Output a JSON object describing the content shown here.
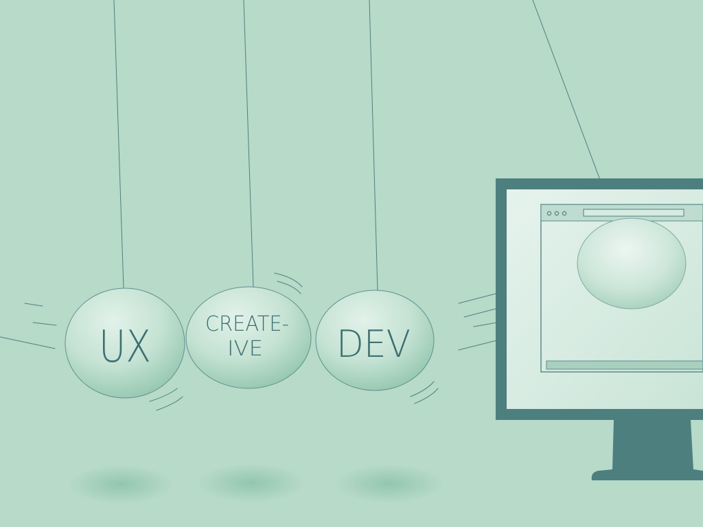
{
  "illustration": {
    "balls": [
      {
        "name": "ux",
        "label_lines": [
          "UX"
        ]
      },
      {
        "name": "create-ive",
        "label_lines": [
          "CREATE-",
          "IVE"
        ]
      },
      {
        "name": "dev",
        "label_lines": [
          "DEV"
        ]
      }
    ],
    "colors": {
      "background": "#b7dac9",
      "ink": "#3d6f70",
      "ball_fill": "#c7e3d6",
      "ball_shade": "#8cc2a9",
      "monitor_frame": "#4e7f7f",
      "screen": "#d6ece2"
    }
  }
}
